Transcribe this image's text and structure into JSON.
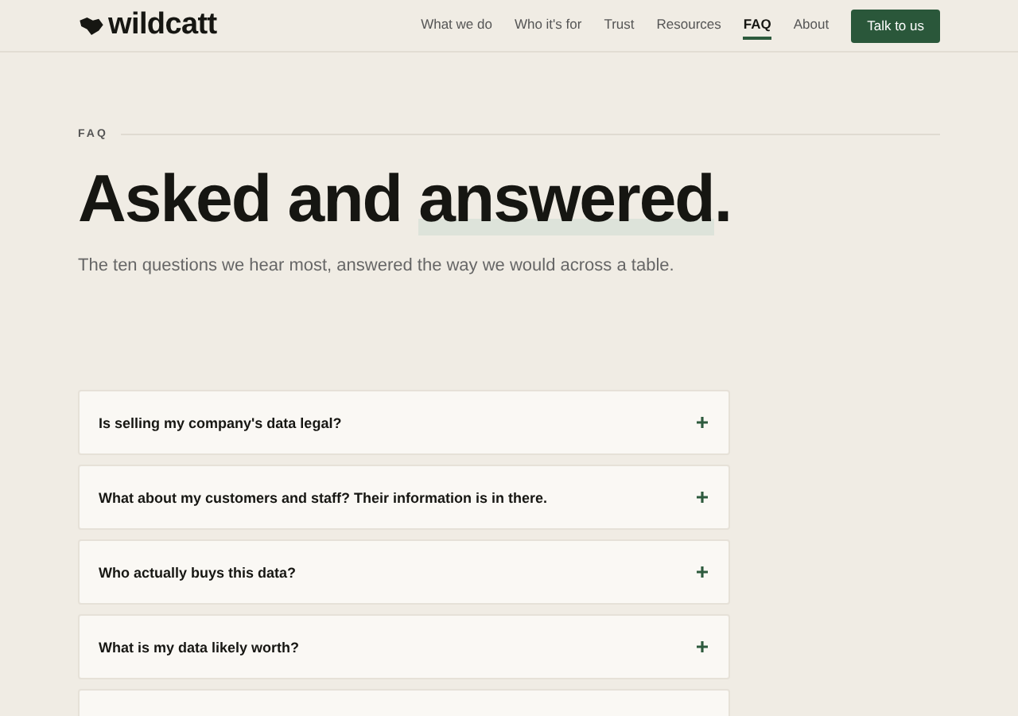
{
  "header": {
    "logo": "wildcatt",
    "nav": [
      {
        "label": "What we do",
        "selected": false
      },
      {
        "label": "Who it's for",
        "selected": false
      },
      {
        "label": "Trust",
        "selected": false
      },
      {
        "label": "Resources",
        "selected": false
      },
      {
        "label": "FAQ",
        "selected": true
      },
      {
        "label": "About",
        "selected": false
      }
    ],
    "cta": "Talk to us"
  },
  "hero": {
    "eyebrow": "FAQ",
    "title": [
      {
        "text": "Asked and ",
        "highlight": false
      },
      {
        "text": "answered",
        "highlight": true
      },
      {
        "text": ".",
        "highlight": false
      }
    ],
    "subtitle": "The ten questions we hear most, answered the way we would across a table."
  },
  "faq": [
    {
      "question": "Is selling my company's data legal?",
      "expanded": false
    },
    {
      "question": "What about my customers and staff? Their information is in there.",
      "expanded": false
    },
    {
      "question": "Who actually buys this data?",
      "expanded": false
    },
    {
      "question": "What is my data likely worth?",
      "expanded": false
    }
  ],
  "faq_more_below": true
}
